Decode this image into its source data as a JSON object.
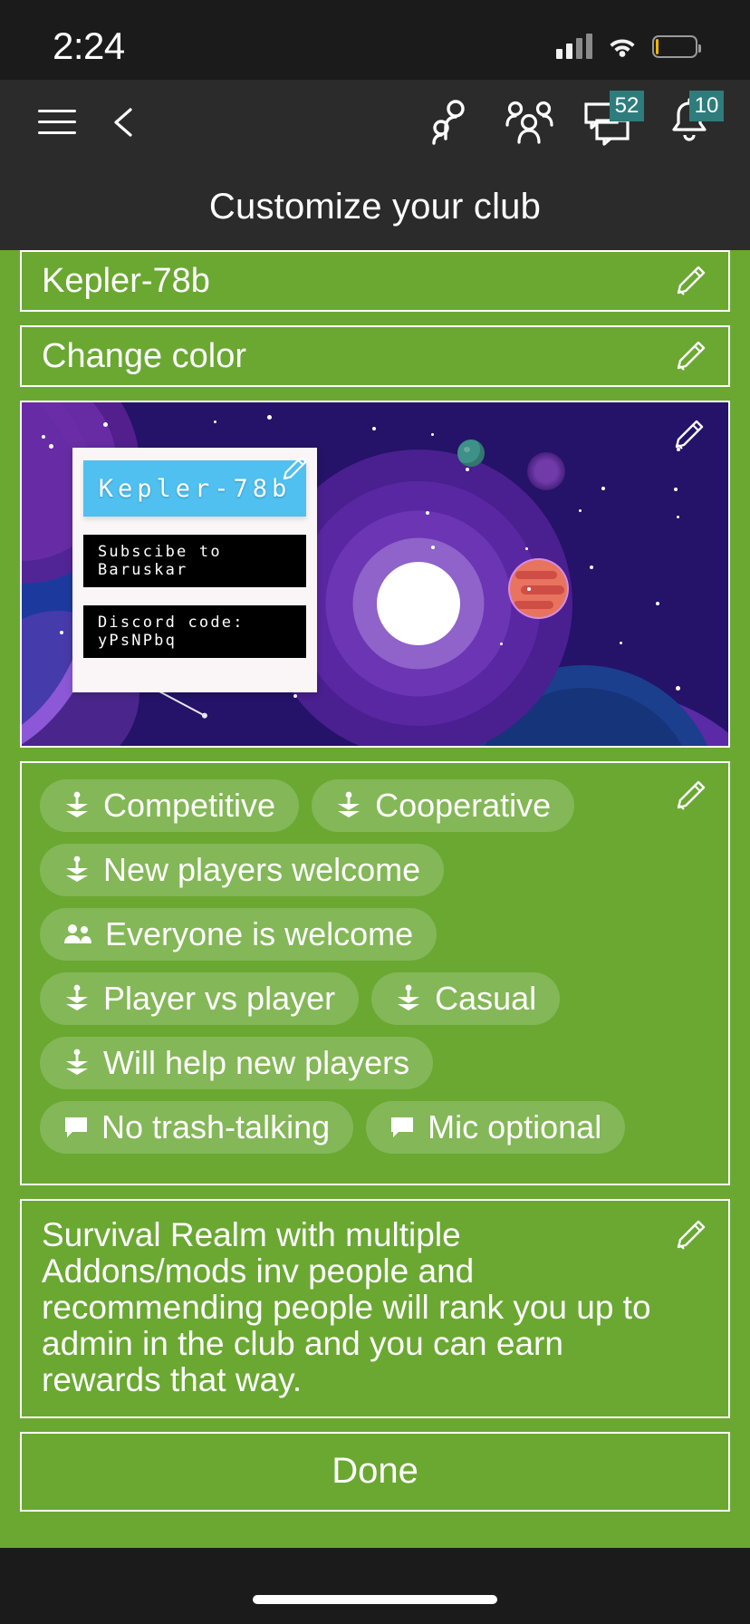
{
  "status_bar": {
    "time": "2:24",
    "icons": [
      "signal-icon",
      "wifi-icon",
      "battery-icon"
    ],
    "battery_level_pct": 8
  },
  "app_bar": {
    "menu_icon": "hamburger-menu-icon",
    "back_icon": "back-arrow-icon",
    "actions": [
      {
        "icon": "friends-icon",
        "badge": ""
      },
      {
        "icon": "party-group-icon",
        "badge": ""
      },
      {
        "icon": "messages-icon",
        "badge": "52"
      },
      {
        "icon": "notifications-bell-icon",
        "badge": "10"
      }
    ]
  },
  "header": {
    "title": "Customize your club"
  },
  "fields": {
    "club_name": {
      "label": "Kepler-78b",
      "edit_icon": "pencil-icon"
    },
    "change_color": {
      "label": "Change color",
      "edit_icon": "pencil-icon"
    }
  },
  "banner": {
    "edit_icon": "pencil-icon",
    "club_card": {
      "title": "Kepler-78b",
      "title_edit_icon": "pencil-icon",
      "chips": [
        "Subscibe to Baruskar",
        "Discord code: yPsNPbq"
      ]
    }
  },
  "tags": {
    "edit_icon": "pencil-icon",
    "rows": [
      [
        {
          "icon": "joystick-icon",
          "label": "Competitive"
        },
        {
          "icon": "joystick-icon",
          "label": "Cooperative"
        }
      ],
      [
        {
          "icon": "joystick-icon",
          "label": "New players welcome"
        }
      ],
      [
        {
          "icon": "people-icon",
          "label": "Everyone is welcome"
        }
      ],
      [
        {
          "icon": "joystick-icon",
          "label": "Player vs player"
        },
        {
          "icon": "joystick-icon",
          "label": "Casual"
        }
      ],
      [
        {
          "icon": "joystick-icon",
          "label": "Will help new players"
        }
      ],
      [
        {
          "icon": "chat-bubble-icon",
          "label": "No trash-talking"
        },
        {
          "icon": "chat-bubble-icon",
          "label": "Mic optional"
        }
      ]
    ]
  },
  "description": {
    "edit_icon": "pencil-icon",
    "text": "Survival Realm with multiple Addons/mods inv people and recommending people will rank you up to admin in the club and you can earn rewards that way."
  },
  "done_button": {
    "label": "Done"
  },
  "colors": {
    "club_accent_green": "#6aa832",
    "app_bar": "#2b2b2b",
    "status_bar": "#1b1b1b",
    "badge_teal": "#2f7c7c",
    "card_header_blue": "#4fc0f0",
    "space_background": "#241368"
  }
}
